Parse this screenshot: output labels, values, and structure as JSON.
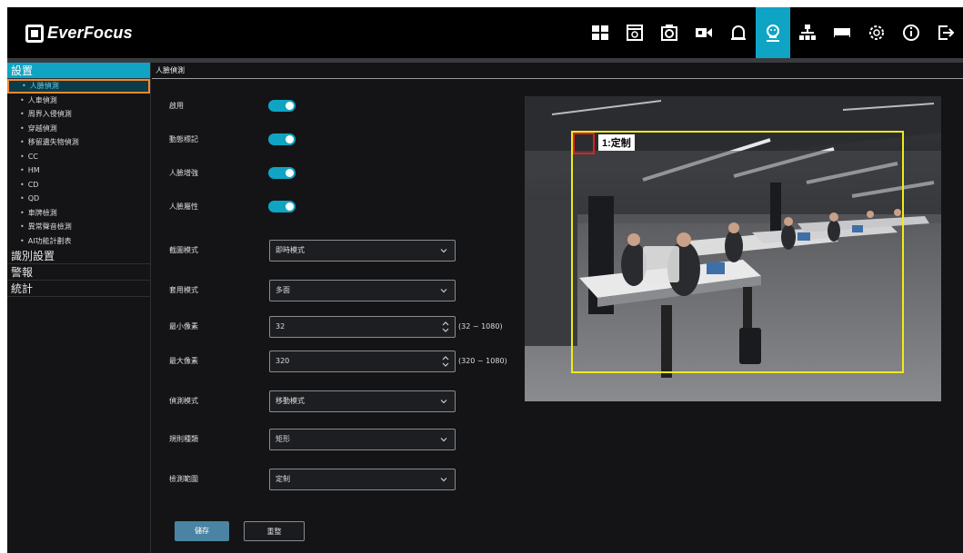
{
  "app": {
    "brand": "EverFocus"
  },
  "toolbar": {
    "items": [
      {
        "icon": "layout-grid-icon"
      },
      {
        "icon": "playback-icon"
      },
      {
        "icon": "snapshot-icon"
      },
      {
        "icon": "record-camera-icon"
      },
      {
        "icon": "alarm-bell-icon"
      },
      {
        "icon": "face-detection-icon",
        "active": true
      },
      {
        "icon": "network-icon"
      },
      {
        "icon": "storage-icon"
      },
      {
        "icon": "settings-gear-icon"
      },
      {
        "icon": "info-icon"
      },
      {
        "icon": "logout-icon"
      }
    ],
    "accent": "#10a4c4"
  },
  "sidebar": {
    "settings_label": "設置",
    "items": [
      {
        "label": "人臉偵測",
        "active": true
      },
      {
        "label": "人車偵測"
      },
      {
        "label": "周界入侵偵測"
      },
      {
        "label": "穿越偵測"
      },
      {
        "label": "移留遺失物偵測"
      },
      {
        "label": "CC"
      },
      {
        "label": "HM"
      },
      {
        "label": "CD"
      },
      {
        "label": "QD"
      },
      {
        "label": "車牌檢測"
      },
      {
        "label": "異常聲音檢測"
      },
      {
        "label": "AI功能計劃表"
      }
    ],
    "sections": [
      {
        "label": "識別設置"
      },
      {
        "label": "警報"
      },
      {
        "label": "統計"
      }
    ]
  },
  "main": {
    "title": "人臉偵測",
    "enable_label": "啟用",
    "motion_mark_label": "動態標記",
    "face_enhance_label": "人臉增強",
    "face_attr_label": "人臉屬性",
    "snap_mode_label": "截圖模式",
    "snap_mode_value": "即時模式",
    "apply_mode_label": "套用模式",
    "apply_mode_value": "多面",
    "min_pixel_label": "最小像素",
    "min_pixel_value": "32",
    "min_pixel_range": "(32 ~ 1080)",
    "max_pixel_label": "最大像素",
    "max_pixel_value": "320",
    "max_pixel_range": "(320 ~ 1080)",
    "detect_mode_label": "偵測模式",
    "detect_mode_value": "移動模式",
    "rule_type_label": "規則種類",
    "rule_type_value": "矩形",
    "detect_range_label": "檢測範圍",
    "detect_range_value": "定制",
    "save_label": "儲存",
    "reset_label": "重整"
  },
  "preview": {
    "zone_label": "1:定制",
    "zone_color": "#f0ea1a",
    "tag_color": "#e02020"
  }
}
